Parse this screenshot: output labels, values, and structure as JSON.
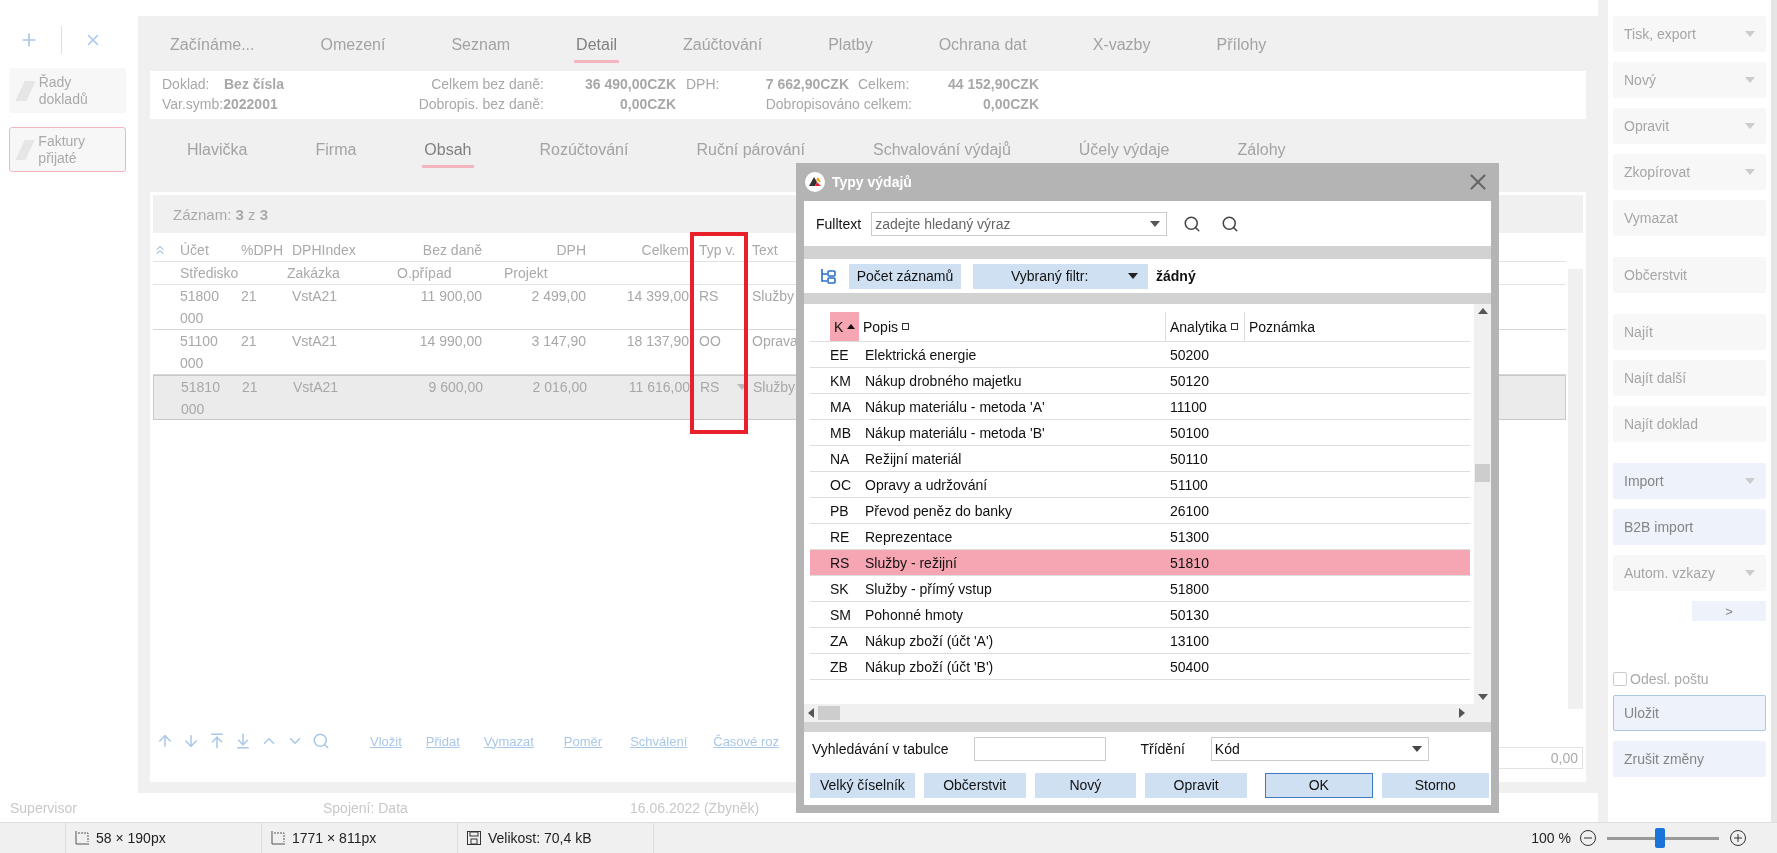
{
  "app_sidebar": {
    "items": [
      {
        "label": "Řady dokladů",
        "selected": false
      },
      {
        "label": "Faktury přijaté",
        "selected": true
      }
    ]
  },
  "main_tabs": [
    {
      "label": "Začínáme...",
      "selected": false
    },
    {
      "label": "Omezení",
      "selected": false
    },
    {
      "label": "Seznam",
      "selected": false
    },
    {
      "label": "Detail",
      "selected": true
    },
    {
      "label": "Zaúčtování",
      "selected": false
    },
    {
      "label": "Platby",
      "selected": false
    },
    {
      "label": "Ochrana dat",
      "selected": false
    },
    {
      "label": "X-vazby",
      "selected": false
    },
    {
      "label": "Přílohy",
      "selected": false
    }
  ],
  "summary": {
    "doklad": {
      "label": "Doklad:",
      "value": "Bez čísla"
    },
    "var_symb": "Var.symb:**2022001**",
    "total_net": {
      "label": "Celkem bez daně:",
      "value": "36 490,00CZK"
    },
    "vat": {
      "label": "DPH:",
      "value": "7 662,90CZK"
    },
    "total": {
      "label": "Celkem:",
      "value": "44 152,90CZK"
    },
    "credit_net": {
      "label": "Dobropis. bez daně:",
      "value": "0,00CZK"
    },
    "credited_total": {
      "label": "Dobropisováno celkem:",
      "value": "0,00CZK"
    }
  },
  "sub_tabs": [
    {
      "label": "Hlavička",
      "selected": false
    },
    {
      "label": "Firma",
      "selected": false
    },
    {
      "label": "Obsah",
      "selected": true
    },
    {
      "label": "Rozúčtování",
      "selected": false
    },
    {
      "label": "Ruční párování",
      "selected": false
    },
    {
      "label": "Schvalování výdajů",
      "selected": false
    },
    {
      "label": "Účely výdaje",
      "selected": false
    },
    {
      "label": "Zálohy",
      "selected": false
    }
  ],
  "items_table": {
    "record": "Záznam: **3** z **3**",
    "columns_1": [
      "Účet",
      "%DPH",
      "DPHIndex",
      "Bez daně",
      "DPH",
      "Celkem",
      "Typ v.",
      "Text"
    ],
    "columns_2": [
      "Středisko",
      "Zakázka",
      "O.případ",
      "Projekt"
    ],
    "rows": [
      {
        "account": "51800",
        "centre": "000",
        "vat_rate": "21",
        "vat_index": "VstA21",
        "net": "11 900,00",
        "vat": "2 499,00",
        "total": "14 399,00",
        "type": "RS",
        "text": "Služby",
        "selected": false
      },
      {
        "account": "51100",
        "centre": "000",
        "vat_rate": "21",
        "vat_index": "VstA21",
        "net": "14 990,00",
        "vat": "3 147,90",
        "total": "18 137,90",
        "type": "OO",
        "text": "Oprava",
        "selected": false
      },
      {
        "account": "51810",
        "centre": "000",
        "vat_rate": "21",
        "vat_index": "VstA21",
        "net": "9 600,00",
        "vat": "2 016,00",
        "total": "11 616,00",
        "type": "RS",
        "text": "Služby",
        "selected": true
      }
    ],
    "footer_value": "0,00"
  },
  "table_actions": [
    "Vložit",
    "Přidat",
    "Vymazat",
    "Poměr",
    "Schválení",
    "Časové roz"
  ],
  "status": {
    "user": "Supervisor",
    "connection": "Spojení: Data",
    "date": "16.06.2022 (Zbyněk)"
  },
  "action_groups": [
    [
      {
        "label": "Tisk, export",
        "kind": "dropdown",
        "disabled": true
      },
      {
        "label": "Nový",
        "kind": "dropdown",
        "disabled": true
      },
      {
        "label": "Opravit",
        "kind": "dropdown",
        "disabled": true
      },
      {
        "label": "Zkopírovat",
        "kind": "dropdown",
        "disabled": true
      },
      {
        "label": "Vymazat",
        "kind": "button",
        "disabled": true
      }
    ],
    [
      {
        "label": "Občerstvit",
        "kind": "button",
        "disabled": true
      }
    ],
    [
      {
        "label": "Najít",
        "kind": "button",
        "disabled": true
      },
      {
        "label": "Najít další",
        "kind": "button",
        "disabled": true
      },
      {
        "label": "Najít doklad",
        "kind": "button",
        "disabled": true
      }
    ],
    [
      {
        "label": "Import",
        "kind": "dropdown",
        "disabled": false
      },
      {
        "label": "B2B import",
        "kind": "button",
        "disabled": false
      },
      {
        "label": "Autom. vzkazy",
        "kind": "dropdown",
        "disabled": true
      },
      {
        "label": ">",
        "kind": "small",
        "disabled": false
      }
    ]
  ],
  "send_mail": {
    "label": "Odesl. poštu",
    "checked": false
  },
  "save_actions": [
    {
      "label": "Uložit",
      "focused": true
    },
    {
      "label": "Zrušit změny",
      "focused": false
    }
  ],
  "dialog": {
    "title": "Typy výdajů",
    "fulltext_label": "Fulltext",
    "fulltext_placeholder": "zadejte hledaný výraz",
    "count_button": "Počet záznamů",
    "filter_label": "Vybraný filtr:",
    "filter_value": "žádný",
    "columns": [
      {
        "label": "K",
        "sorted": true,
        "marker": false
      },
      {
        "label": "Popis",
        "sorted": false,
        "marker": true
      },
      {
        "label": "Analytika",
        "sorted": false,
        "marker": true
      },
      {
        "label": "Poznámka",
        "sorted": false,
        "marker": false
      }
    ],
    "rows": [
      {
        "code": "EE",
        "description": "Elektrická energie",
        "analytics": "50200",
        "selected": false
      },
      {
        "code": "KM",
        "description": "Nákup drobného majetku",
        "analytics": "50120",
        "selected": false
      },
      {
        "code": "MA",
        "description": "Nákup materiálu - metoda 'A'",
        "analytics": "11100",
        "selected": false
      },
      {
        "code": "MB",
        "description": "Nákup materiálu - metoda 'B'",
        "analytics": "50100",
        "selected": false
      },
      {
        "code": "NA",
        "description": "Režijní materiál",
        "analytics": "50110",
        "selected": false
      },
      {
        "code": "OC",
        "description": "Opravy a udržování",
        "analytics": "51100",
        "selected": false
      },
      {
        "code": "PB",
        "description": "Převod peněz do banky",
        "analytics": "26100",
        "selected": false
      },
      {
        "code": "RE",
        "description": "Reprezentace",
        "analytics": "51300",
        "selected": false
      },
      {
        "code": "RS",
        "description": "Služby - režijní",
        "analytics": "51810",
        "selected": true
      },
      {
        "code": "SK",
        "description": "Služby - přímý vstup",
        "analytics": "51800",
        "selected": false
      },
      {
        "code": "SM",
        "description": "Pohonné hmoty",
        "analytics": "50130",
        "selected": false
      },
      {
        "code": "ZA",
        "description": "Nákup zboží (účt 'A')",
        "analytics": "13100",
        "selected": false
      },
      {
        "code": "ZB",
        "description": "Nákup zboží (účt 'B')",
        "analytics": "50400",
        "selected": false
      }
    ],
    "table_search_label": "Vyhledávání v tabulce",
    "sort_label": "Třídění",
    "sort_value": "Kód",
    "buttons": [
      {
        "label": "Velký číselník",
        "kind": "action",
        "focused": false
      },
      {
        "label": "Občerstvit",
        "kind": "action",
        "focused": false
      },
      {
        "label": "Nový",
        "kind": "action",
        "focused": false
      },
      {
        "label": "Opravit",
        "kind": "action",
        "focused": false
      },
      {
        "label": "OK",
        "kind": "confirm",
        "focused": true
      },
      {
        "label": "Storno",
        "kind": "confirm",
        "focused": false
      }
    ]
  },
  "taskbar": {
    "selection": "58 × 190px",
    "dimensions": "1771 × 811px",
    "size": "Velikost: 70,4 kB",
    "zoom": "100 %",
    "zoom_slider": {
      "level": 0.47
    }
  }
}
